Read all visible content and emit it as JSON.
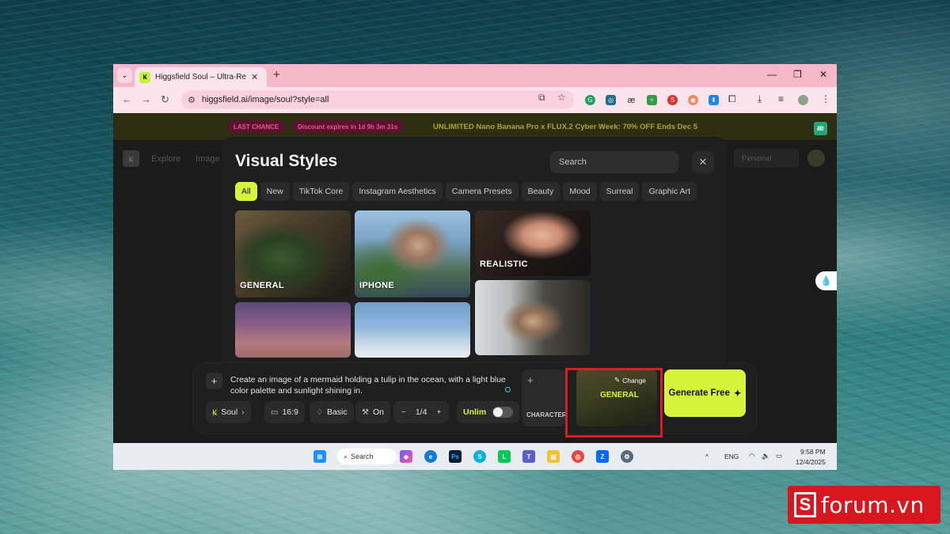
{
  "browser": {
    "tab_list_icon": "chevron-down-icon",
    "tab_title": "Higgsfield Soul – Ultra-Realistic",
    "tab_favicon_text": "Ꝃ",
    "tab_close": "✕",
    "new_tab": "+",
    "minimize": "—",
    "restore": "❐",
    "close": "✕",
    "url": "higgsfield.ai/image/soul?style=all"
  },
  "banner": {
    "badge1": "LAST CHANCE",
    "badge2": "Discount expires in 1d 9h 3m 31s",
    "text": "UNLIMITED Nano Banana Pro x FLUX.2 Cyber Week: 70% OFF Ends Dec 5",
    "logo": "æ"
  },
  "site": {
    "nav_explore": "Explore",
    "nav_image": "Image",
    "account": "Personal"
  },
  "modal": {
    "title": "Visual Styles",
    "search_placeholder": "Search",
    "close": "✕",
    "chips": [
      "All",
      "New",
      "TikTok Core",
      "Instagram Aesthetics",
      "Camera Presets",
      "Beauty",
      "Mood",
      "Surreal",
      "Graphic Art"
    ],
    "cards": {
      "general": "GENERAL",
      "iphone": "IPHONE",
      "realistic": "REALISTIC"
    }
  },
  "prompt": {
    "text": "Create an image of a mermaid holding a tulip in the ocean, with a light blue color palette and sunlight shining in.",
    "model": "Soul",
    "aspect": "16:9",
    "quality": "Basic",
    "enhance": "On",
    "count": "1/4",
    "unlim": "Unlim",
    "character_label": "CHARACTER",
    "style_change": "Change",
    "style_label": "GENERAL",
    "generate": "Generate Free"
  },
  "taskbar": {
    "search": "Search",
    "lang": "ENG",
    "time": "9:58 PM",
    "date": "12/4/2025",
    "teams_badge": "✓",
    "zalo_badge": "5+"
  },
  "watermark": {
    "text": "forum.vn",
    "box": "S"
  },
  "colors": {
    "accent": "#d6f53a",
    "tab_bar": "#f6b7cb",
    "highlight": "#d61f26"
  }
}
